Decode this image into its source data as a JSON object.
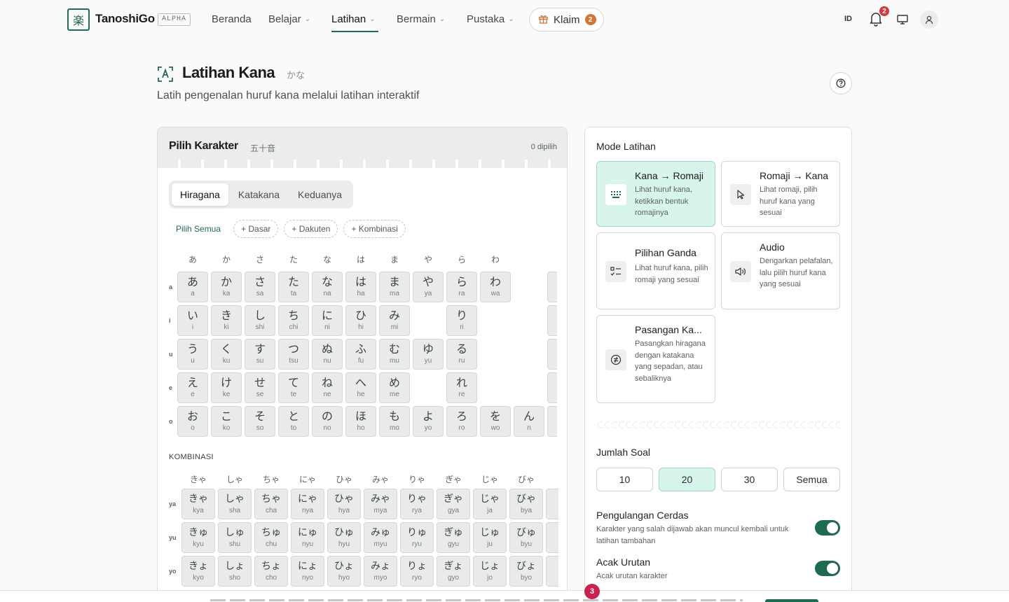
{
  "header": {
    "brand": "TanoshiGo",
    "badge": "ALPHA",
    "logo_glyph": "楽",
    "nav": [
      {
        "label": "Beranda",
        "chevron": false
      },
      {
        "label": "Belajar",
        "chevron": true
      },
      {
        "label": "Latihan",
        "chevron": true,
        "active": true
      },
      {
        "label": "Bermain",
        "chevron": true
      },
      {
        "label": "Pustaka",
        "chevron": true
      }
    ],
    "claim_label": "Klaim",
    "claim_count": "2",
    "lang": "ID",
    "notif_count": "2"
  },
  "page": {
    "title": "Latihan Kana",
    "title_kana": "かな",
    "subtitle": "Latih pengenalan huruf kana melalui latihan interaktif"
  },
  "selector": {
    "title": "Pilih Karakter",
    "title_kana": "五十音",
    "count_label": "0 dipilih",
    "tabs": [
      "Hiragana",
      "Katakana",
      "Keduanya"
    ],
    "active_tab": "Hiragana",
    "pick_all": "Pilih Semua",
    "filters": [
      "+ Dasar",
      "+ Dakuten",
      "+ Kombinasi"
    ],
    "gojuon_columns": [
      "あ",
      "か",
      "さ",
      "た",
      "な",
      "は",
      "ま",
      "や",
      "ら",
      "わ"
    ],
    "gojuon_rows": [
      {
        "label": "a",
        "cells": [
          [
            "あ",
            "a"
          ],
          [
            "か",
            "ka"
          ],
          [
            "さ",
            "sa"
          ],
          [
            "た",
            "ta"
          ],
          [
            "な",
            "na"
          ],
          [
            "は",
            "ha"
          ],
          [
            "ま",
            "ma"
          ],
          [
            "や",
            "ya"
          ],
          [
            "ら",
            "ra"
          ],
          [
            "わ",
            "wa"
          ],
          null
        ]
      },
      {
        "label": "i",
        "cells": [
          [
            "い",
            "i"
          ],
          [
            "き",
            "ki"
          ],
          [
            "し",
            "shi"
          ],
          [
            "ち",
            "chi"
          ],
          [
            "に",
            "ni"
          ],
          [
            "ひ",
            "hi"
          ],
          [
            "み",
            "mi"
          ],
          null,
          [
            "り",
            "ri"
          ],
          null,
          null
        ]
      },
      {
        "label": "u",
        "cells": [
          [
            "う",
            "u"
          ],
          [
            "く",
            "ku"
          ],
          [
            "す",
            "su"
          ],
          [
            "つ",
            "tsu"
          ],
          [
            "ぬ",
            "nu"
          ],
          [
            "ふ",
            "fu"
          ],
          [
            "む",
            "mu"
          ],
          [
            "ゆ",
            "yu"
          ],
          [
            "る",
            "ru"
          ],
          null,
          null
        ]
      },
      {
        "label": "e",
        "cells": [
          [
            "え",
            "e"
          ],
          [
            "け",
            "ke"
          ],
          [
            "せ",
            "se"
          ],
          [
            "て",
            "te"
          ],
          [
            "ね",
            "ne"
          ],
          [
            "へ",
            "he"
          ],
          [
            "め",
            "me"
          ],
          null,
          [
            "れ",
            "re"
          ],
          null,
          null
        ]
      },
      {
        "label": "o",
        "cells": [
          [
            "お",
            "o"
          ],
          [
            "こ",
            "ko"
          ],
          [
            "そ",
            "so"
          ],
          [
            "と",
            "to"
          ],
          [
            "の",
            "no"
          ],
          [
            "ほ",
            "ho"
          ],
          [
            "も",
            "mo"
          ],
          [
            "よ",
            "yo"
          ],
          [
            "ろ",
            "ro"
          ],
          [
            "を",
            "wo"
          ],
          [
            "ん",
            "n"
          ]
        ]
      }
    ],
    "kombinasi_label": "KOMBINASI",
    "komb_columns": [
      "きゃ",
      "しゃ",
      "ちゃ",
      "にゃ",
      "ひゃ",
      "みゃ",
      "りゃ",
      "ぎゃ",
      "じゃ",
      "びゃ",
      "ぴ"
    ],
    "komb_rows": [
      {
        "label": "ya",
        "cells": [
          [
            "きゃ",
            "kya"
          ],
          [
            "しゃ",
            "sha"
          ],
          [
            "ちゃ",
            "cha"
          ],
          [
            "にゃ",
            "nya"
          ],
          [
            "ひゃ",
            "hya"
          ],
          [
            "みゃ",
            "mya"
          ],
          [
            "りゃ",
            "rya"
          ],
          [
            "ぎゃ",
            "gya"
          ],
          [
            "じゃ",
            "ja"
          ],
          [
            "びゃ",
            "bya"
          ],
          [
            "ぴ",
            "p"
          ]
        ]
      },
      {
        "label": "yu",
        "cells": [
          [
            "きゅ",
            "kyu"
          ],
          [
            "しゅ",
            "shu"
          ],
          [
            "ちゅ",
            "chu"
          ],
          [
            "にゅ",
            "nyu"
          ],
          [
            "ひゅ",
            "hyu"
          ],
          [
            "みゅ",
            "myu"
          ],
          [
            "りゅ",
            "ryu"
          ],
          [
            "ぎゅ",
            "gyu"
          ],
          [
            "じゅ",
            "ju"
          ],
          [
            "びゅ",
            "byu"
          ],
          [
            "ぴ",
            "p"
          ]
        ]
      },
      {
        "label": "yo",
        "cells": [
          [
            "きょ",
            "kyo"
          ],
          [
            "しょ",
            "sho"
          ],
          [
            "ちょ",
            "cho"
          ],
          [
            "にょ",
            "nyo"
          ],
          [
            "ひょ",
            "hyo"
          ],
          [
            "みょ",
            "myo"
          ],
          [
            "りょ",
            "ryo"
          ],
          [
            "ぎょ",
            "gyo"
          ],
          [
            "じょ",
            "jo"
          ],
          [
            "びょ",
            "byo"
          ],
          [
            "ぴ",
            "p"
          ]
        ]
      }
    ]
  },
  "settings": {
    "mode_label": "Mode Latihan",
    "modes": [
      {
        "title": "Kana → Romaji",
        "desc": "Lihat huruf kana, ketikkan bentuk romajinya",
        "icon": "keyboard-icon",
        "selected": true
      },
      {
        "title": "Romaji → Kana",
        "desc": "Lihat romaji, pilih huruf kana yang sesuai",
        "icon": "cursor-icon",
        "selected": false
      },
      {
        "title": "Pilihan Ganda",
        "desc": "Lihat huruf kana, pilih romaji yang sesuai",
        "icon": "list-check-icon",
        "selected": false
      },
      {
        "title": "Audio",
        "desc": "Dengarkan pelafalan, lalu pilih huruf kana yang sesuai",
        "icon": "speaker-icon",
        "selected": false
      },
      {
        "title": "Pasangan Ka...",
        "desc": "Pasangkan hiragana dengan katakana yang sepadan, atau sebaliknya",
        "icon": "equal-circle-icon",
        "selected": false
      }
    ],
    "count_label": "Jumlah Soal",
    "counts": [
      "10",
      "20",
      "30",
      "Semua"
    ],
    "selected_count": "20",
    "smart_repeat_title": "Pengulangan Cerdas",
    "smart_repeat_desc": "Karakter yang salah dijawab akan muncul kembali untuk latihan tambahan",
    "smart_repeat_on": true,
    "shuffle_title": "Acak Urutan",
    "shuffle_desc": "Acak urutan karakter",
    "shuffle_on": true
  },
  "floating_badge": "3",
  "colors": {
    "accent": "#1f6b4f",
    "accent_soft": "#d8f5ea",
    "warn": "#d27638",
    "alert": "#d23a3a"
  }
}
